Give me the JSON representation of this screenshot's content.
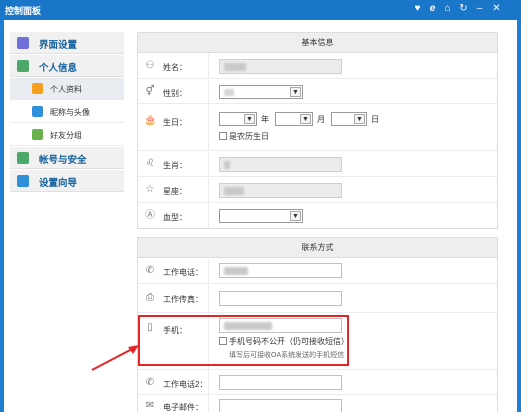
{
  "window": {
    "title": "控制面板",
    "controls": [
      "heart-icon",
      "ie-icon",
      "home-icon",
      "refresh-icon",
      "minimize-icon",
      "close-icon"
    ]
  },
  "sidebar": {
    "sections": [
      {
        "label": "界面设置",
        "icon": "palette-icon",
        "color": "#6f6fd8"
      },
      {
        "label": "个人信息",
        "icon": "person-icon",
        "color": "#4ba86a",
        "items": [
          {
            "label": "个人资料",
            "icon": "profile-card-icon",
            "color": "#f2a01e",
            "active": true
          },
          {
            "label": "昵称与头像",
            "icon": "avatar-icon",
            "color": "#2f8fd8"
          },
          {
            "label": "好友分组",
            "icon": "heart-icon",
            "color": "#6ab04c"
          }
        ]
      },
      {
        "label": "帐号与安全",
        "icon": "shield-icon",
        "color": "#4ba86a"
      },
      {
        "label": "设置向导",
        "icon": "wizard-icon",
        "color": "#2f8fd8"
      }
    ]
  },
  "basic": {
    "header": "基本信息",
    "name_label": "姓名：",
    "gender_label": "性别：",
    "birthday_label": "生日：",
    "year_unit": "年",
    "month_unit": "月",
    "day_unit": "日",
    "lunar_label": "是农历生日",
    "zodiac_label": "生肖：",
    "constellation_label": "星座：",
    "blood_label": "血型："
  },
  "contact": {
    "header": "联系方式",
    "work_phone_label": "工作电话：",
    "work_fax_label": "工作传真：",
    "mobile_label": "手机：",
    "mobile_private_label": "手机号码不公开（仍可接收短信）",
    "mobile_hint": "填写后可接收OA系统发送的手机短信",
    "work_phone2_label": "工作电话2：",
    "email_label": "电子邮件："
  },
  "colors": {
    "titlebar": "#1976c9",
    "annotation": "#e42626"
  }
}
